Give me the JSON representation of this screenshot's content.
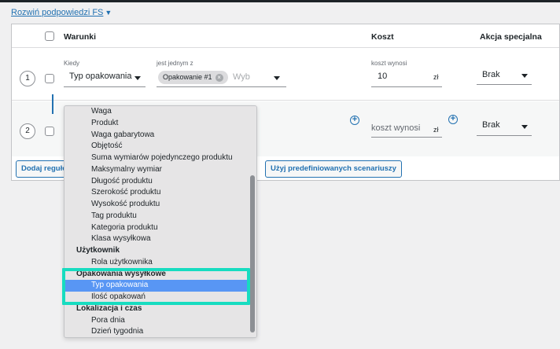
{
  "header": {
    "toggle_label": "Rozwiń podpowiedzi FS",
    "toggle_arrow": "▼"
  },
  "table": {
    "columns": {
      "conditions": "Warunki",
      "cost": "Koszt",
      "special": "Akcja specjalna"
    },
    "rows": [
      {
        "number": "1",
        "when_label": "Kiedy",
        "when_value": "Typ opakowania",
        "is_one_of_label": "jest jednym z",
        "chip": "Opakowanie #1",
        "search_placeholder": "Wyb",
        "cost_label": "koszt wynosi",
        "cost_value": "10",
        "currency": "zł",
        "action": "Brak"
      },
      {
        "number": "2",
        "cost_placeholder": "koszt wynosi",
        "currency": "zł",
        "action": "Brak"
      }
    ]
  },
  "buttons": {
    "add_rule": "Dodaj regułę",
    "predefined": "Użyj predefiniowanych scenariuszy"
  },
  "dropdown": {
    "items": [
      {
        "label": "Waga",
        "type": "option"
      },
      {
        "label": "Produkt",
        "type": "option"
      },
      {
        "label": "Waga gabarytowa",
        "type": "option"
      },
      {
        "label": "Objętość",
        "type": "option"
      },
      {
        "label": "Suma wymiarów pojedynczego produktu",
        "type": "option"
      },
      {
        "label": "Maksymalny wymiar",
        "type": "option"
      },
      {
        "label": "Długość produktu",
        "type": "option"
      },
      {
        "label": "Szerokość produktu",
        "type": "option"
      },
      {
        "label": "Wysokość produktu",
        "type": "option"
      },
      {
        "label": "Tag produktu",
        "type": "option"
      },
      {
        "label": "Kategoria produktu",
        "type": "option"
      },
      {
        "label": "Klasa wysyłkowa",
        "type": "option"
      },
      {
        "label": "Użytkownik",
        "type": "group"
      },
      {
        "label": "Rola użytkownika",
        "type": "option"
      },
      {
        "label": "Opakowania wysyłkowe",
        "type": "group"
      },
      {
        "label": "Typ opakowania",
        "type": "option",
        "selected": true
      },
      {
        "label": "Ilość opakowań",
        "type": "option"
      },
      {
        "label": "Lokalizacja i czas",
        "type": "group"
      },
      {
        "label": "Pora dnia",
        "type": "option"
      },
      {
        "label": "Dzień tygodnia",
        "type": "option"
      }
    ]
  },
  "colors": {
    "accent": "#2271b1",
    "highlight": "#17dcc0",
    "selected": "#5896f4"
  }
}
